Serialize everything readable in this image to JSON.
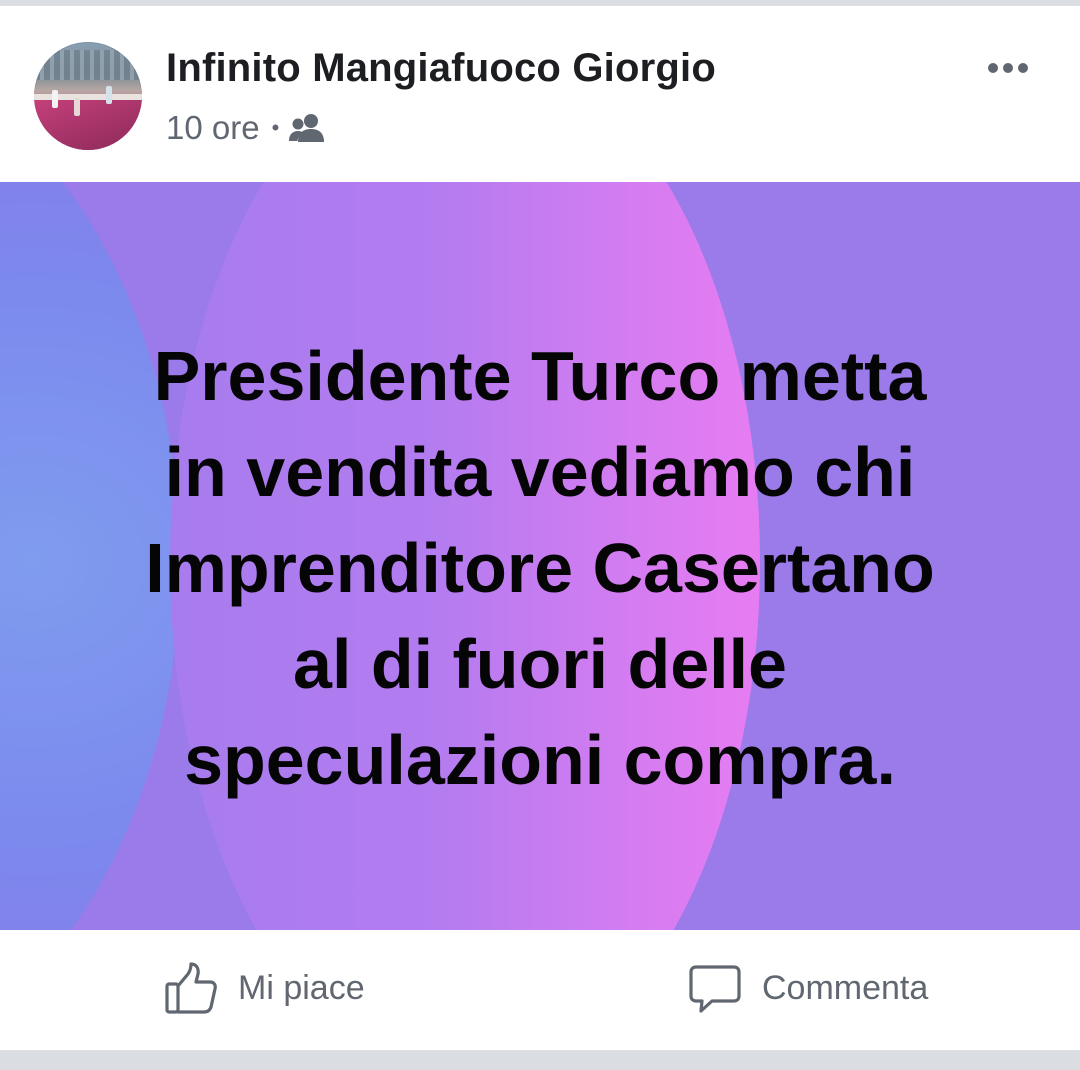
{
  "post": {
    "author": "Infinito Mangiafuoco Giorgio",
    "time": "10 ore",
    "separator": "•",
    "audience_icon": "friends-icon",
    "more_icon": "more-options-icon",
    "text": "Presidente Turco metta\nin vendita vediamo chi\nImprenditore Casertano\nal di fuori delle\nspeculazioni compra."
  },
  "actions": {
    "like_label": "Mi piace",
    "like_icon": "thumbs-up-icon",
    "comment_label": "Commenta",
    "comment_icon": "comment-icon"
  },
  "colors": {
    "background_purple": "#9b7ae9",
    "gradient_pink": "#e77cf2",
    "gradient_blue": "#7f9cef",
    "text_secondary": "#606770",
    "text_primary": "#1c1e21"
  }
}
